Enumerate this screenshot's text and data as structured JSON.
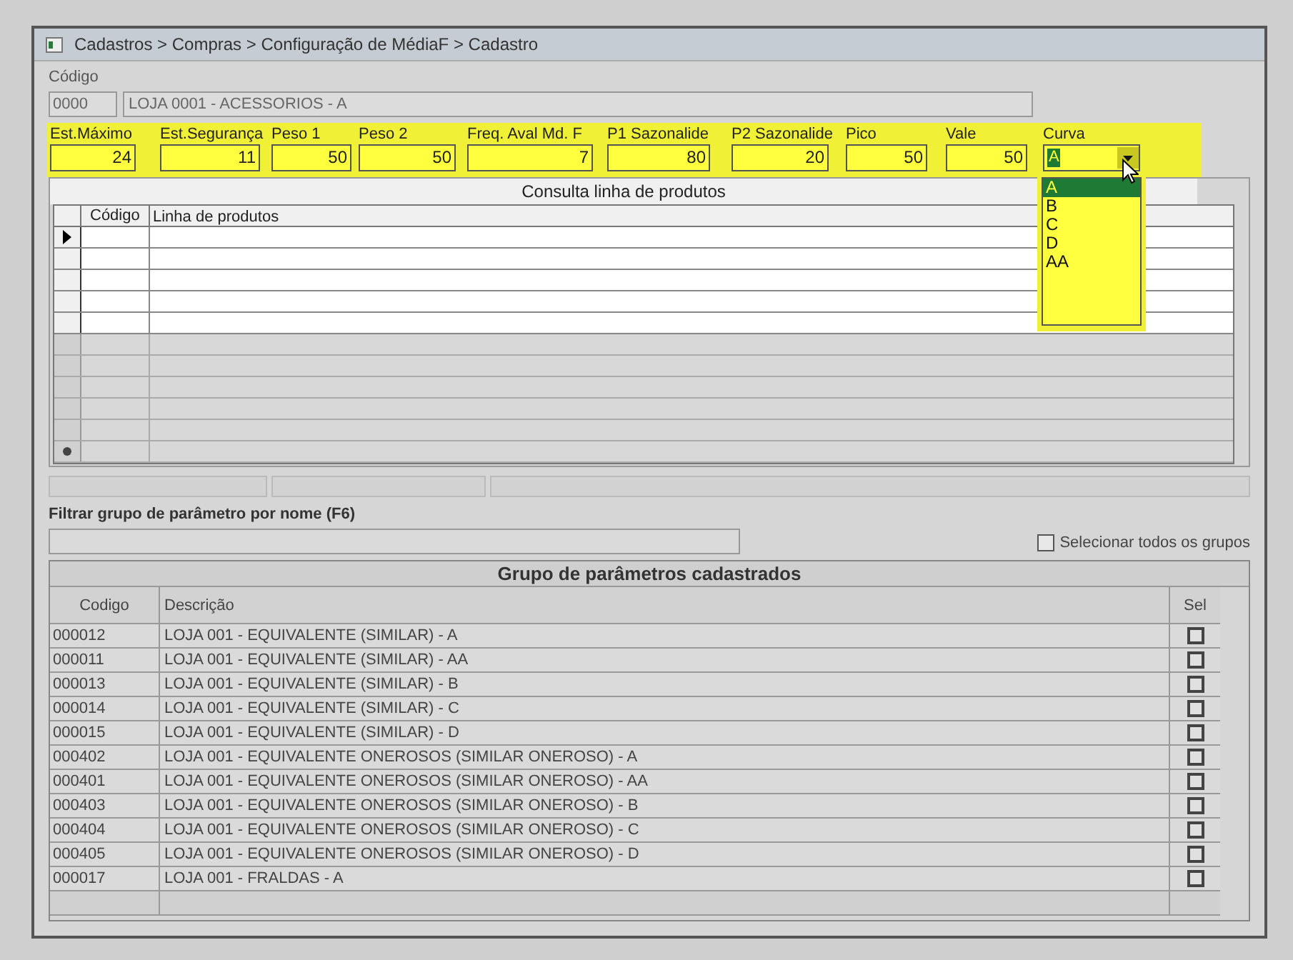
{
  "window": {
    "title": "Cadastros > Compras > Configuração de MédiaF > Cadastro"
  },
  "codigo": {
    "label": "Código",
    "code": "0000",
    "name": "LOJA 0001 - ACESSORIOS - A"
  },
  "parameters": [
    {
      "label": "Est.Máximo",
      "value": "24"
    },
    {
      "label": "Est.Segurança",
      "value": "11"
    },
    {
      "label": "Peso 1",
      "value": "50"
    },
    {
      "label": "Peso 2",
      "value": "50"
    },
    {
      "label": "Freq. Aval Md. F",
      "value": "7"
    },
    {
      "label": "P1 Sazonalide",
      "value": "80"
    },
    {
      "label": "P2 Sazonalide",
      "value": "20"
    },
    {
      "label": "Pico",
      "value": "50"
    },
    {
      "label": "Vale",
      "value": "50"
    }
  ],
  "curva": {
    "label": "Curva",
    "value": "A",
    "expanded": true,
    "options": [
      {
        "label": "A",
        "selected": true
      },
      {
        "label": "B",
        "selected": false
      },
      {
        "label": "C",
        "selected": false
      },
      {
        "label": "D",
        "selected": false
      },
      {
        "label": "AA",
        "selected": false
      }
    ]
  },
  "product_lines": {
    "title": "Consulta linha de produtos",
    "columns": [
      "Código",
      "Linha de produtos"
    ]
  },
  "filter": {
    "label": "Filtrar grupo de parâmetro por nome (F6)"
  },
  "select_all": {
    "label": "Selecionar todos os grupos",
    "checked": false
  },
  "groups": {
    "title": "Grupo de parâmetros cadastrados",
    "columns": [
      "Codigo",
      "Descrição",
      "Sel"
    ],
    "rows": [
      {
        "code": "000012",
        "description": "LOJA 001 - EQUIVALENTE (SIMILAR) - A",
        "selected": false
      },
      {
        "code": "000011",
        "description": "LOJA 001 - EQUIVALENTE (SIMILAR) - AA",
        "selected": false
      },
      {
        "code": "000013",
        "description": "LOJA 001 - EQUIVALENTE (SIMILAR) - B",
        "selected": false
      },
      {
        "code": "000014",
        "description": "LOJA 001 - EQUIVALENTE (SIMILAR) - C",
        "selected": false
      },
      {
        "code": "000015",
        "description": "LOJA 001 - EQUIVALENTE (SIMILAR) - D",
        "selected": false
      },
      {
        "code": "000402",
        "description": "LOJA 001 - EQUIVALENTE ONEROSOS (SIMILAR ONEROSO) - A",
        "selected": false
      },
      {
        "code": "000401",
        "description": "LOJA 001 - EQUIVALENTE ONEROSOS (SIMILAR ONEROSO) - AA",
        "selected": false
      },
      {
        "code": "000403",
        "description": "LOJA 001 - EQUIVALENTE ONEROSOS (SIMILAR ONEROSO) - B",
        "selected": false
      },
      {
        "code": "000404",
        "description": "LOJA 001 - EQUIVALENTE ONEROSOS (SIMILAR ONEROSO) - C",
        "selected": false
      },
      {
        "code": "000405",
        "description": "LOJA 001 - EQUIVALENTE ONEROSOS (SIMILAR ONEROSO) - D",
        "selected": false
      },
      {
        "code": "000017",
        "description": "LOJA 001 - FRALDAS - A",
        "selected": false
      }
    ]
  }
}
